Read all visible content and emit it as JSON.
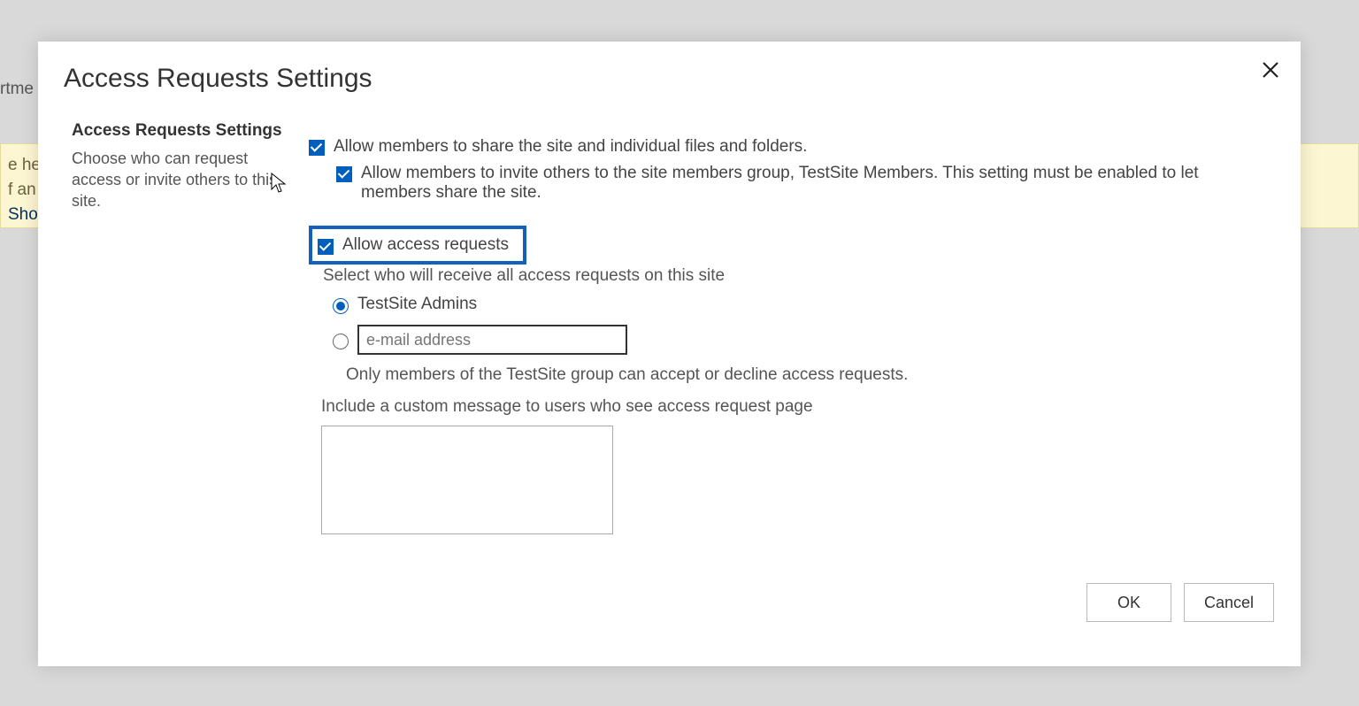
{
  "background": {
    "nav_fragment": "rtme",
    "yellow_line1": "e her",
    "yellow_line2": "f an it",
    "yellow_line3": "Show"
  },
  "dialog": {
    "title": "Access Requests Settings",
    "left": {
      "heading": "Access Requests Settings",
      "description": "Choose who can request access or invite others to this site."
    },
    "checkboxes": {
      "allow_share": {
        "label": "Allow members to share the site and individual files and folders.",
        "checked": true
      },
      "allow_invite": {
        "label": "Allow members to invite others to the site members group, TestSite Members. This setting must be enabled to let members share the site.",
        "checked": true
      },
      "allow_access_requests": {
        "label": "Allow access requests",
        "checked": true
      }
    },
    "receiver_label": "Select who will receive all access requests on this site",
    "radios": {
      "admins": {
        "label": "TestSite Admins",
        "selected": true
      },
      "email": {
        "placeholder": "e-mail address",
        "selected": false
      }
    },
    "group_note": "Only members of the TestSite group can accept or decline access requests.",
    "custom_msg_label": "Include a custom message to users who see access request page",
    "buttons": {
      "ok": "OK",
      "cancel": "Cancel"
    }
  }
}
